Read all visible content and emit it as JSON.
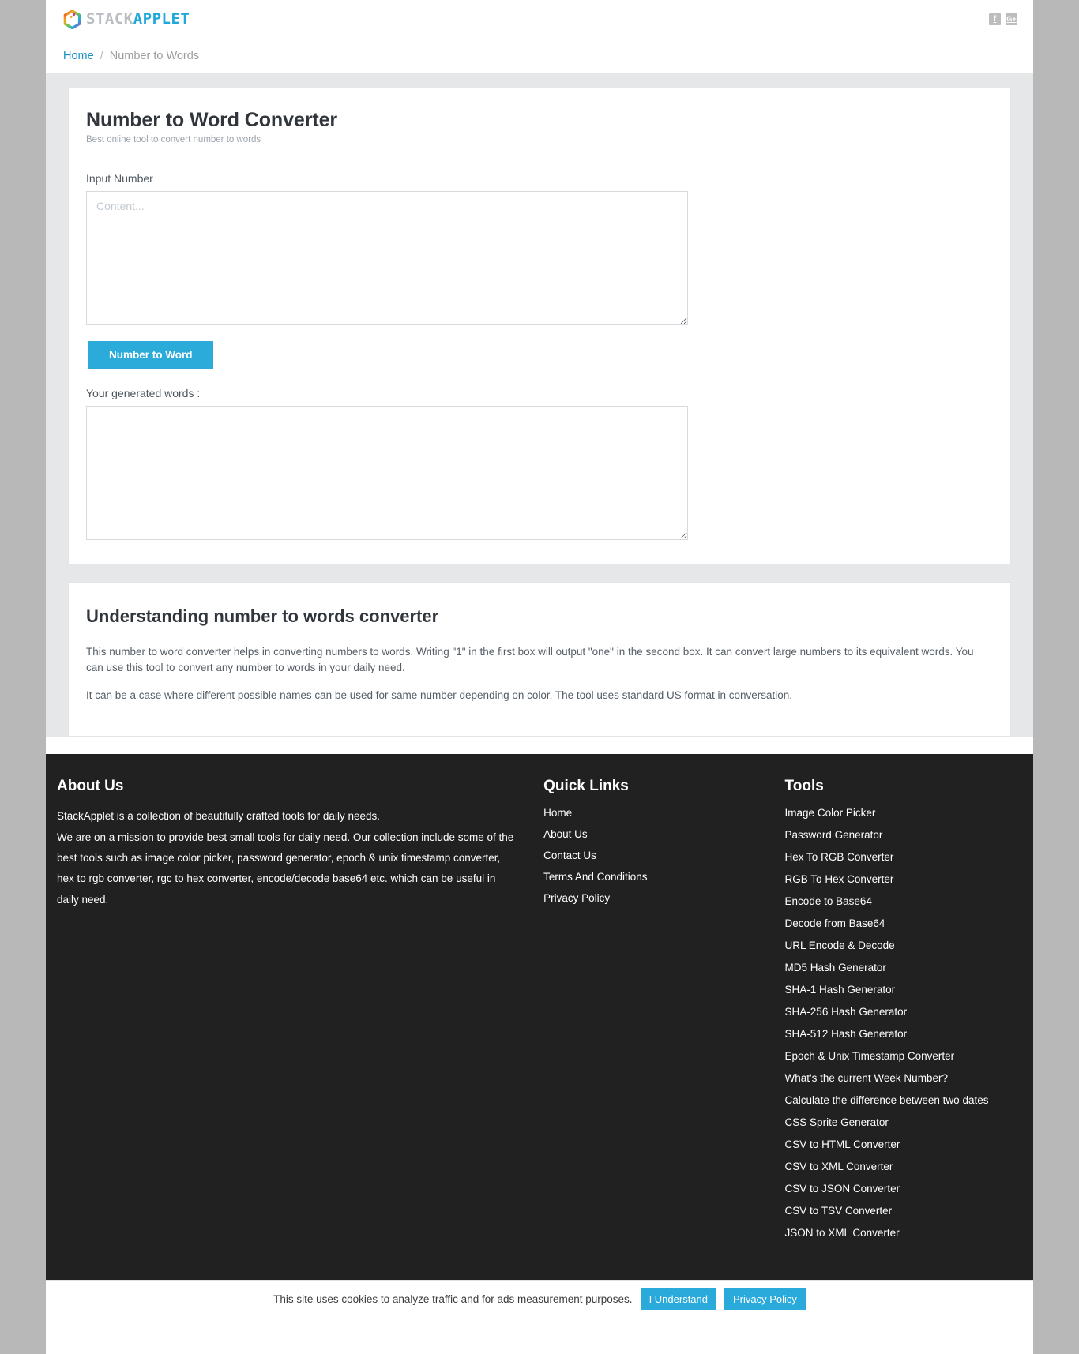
{
  "header": {
    "brand_stack": "STACK",
    "brand_applet": "APPLET",
    "logo_icon": "hexagon-rainbow-icon",
    "social": [
      {
        "name": "facebook-icon",
        "glyph": "f"
      },
      {
        "name": "google-plus-icon",
        "glyph": "G+"
      }
    ]
  },
  "breadcrumb": {
    "home": "Home",
    "separator": "/",
    "current": "Number to Words"
  },
  "tool": {
    "title": "Number to Word Converter",
    "subtitle": "Best online tool to convert number to words",
    "input_label": "Input Number",
    "input_placeholder": "Content...",
    "input_value": "",
    "button_label": "Number to Word",
    "output_label": "Your generated words :",
    "output_value": ""
  },
  "info": {
    "title": "Understanding number to words converter",
    "paragraphs": [
      "This number to word converter helps in converting numbers to words. Writing \"1\" in the first box will output \"one\" in the second box. It can convert large numbers to its equivalent words. You can use this tool to convert any number to words in your daily need.",
      "It can be a case where different possible names can be used for same number depending on color. The tool uses standard US format in conversation."
    ]
  },
  "footer": {
    "about": {
      "heading": "About Us",
      "line1": "StackApplet is a collection of beautifully crafted tools for daily needs.",
      "line2": "We are on a mission to provide best small tools for daily need. Our collection include some of the best tools such as image color picker, password generator, epoch & unix timestamp converter, hex to rgb converter, rgc to hex converter, encode/decode base64 etc. which can be useful in daily need."
    },
    "quick_links": {
      "heading": "Quick Links",
      "items": [
        "Home",
        "About Us",
        "Contact Us",
        "Terms And Conditions",
        "Privacy Policy"
      ]
    },
    "tools": {
      "heading": "Tools",
      "items": [
        "Image Color Picker",
        "Password Generator",
        "Hex To RGB Converter",
        "RGB To Hex Converter",
        "Encode to Base64",
        "Decode from Base64",
        "URL Encode & Decode",
        "MD5 Hash Generator",
        "SHA-1 Hash Generator",
        "SHA-256 Hash Generator",
        "SHA-512 Hash Generator",
        "Epoch & Unix Timestamp Converter",
        "What's the current Week Number?",
        "Calculate the difference between two dates",
        "CSS Sprite Generator",
        "CSV to HTML Converter",
        "CSV to XML Converter",
        "CSV to JSON Converter",
        "CSV to TSV Converter",
        "JSON to XML Converter"
      ]
    }
  },
  "cookie": {
    "message": "This site uses cookies to analyze traffic and for ads measurement purposes.",
    "accept_label": "I Understand",
    "policy_label": "Privacy Policy"
  },
  "colors": {
    "accent": "#29aadb",
    "brand_gray": "#b9bcc0",
    "link": "#1a8fc4",
    "footer_bg": "#212121",
    "canvas_bg": "#e6e7e8"
  }
}
